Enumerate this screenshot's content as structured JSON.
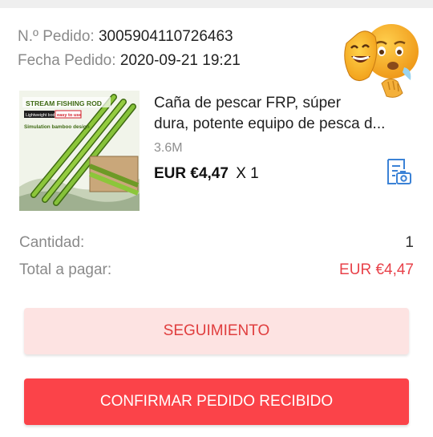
{
  "order": {
    "number_label": "N.º Pedido:",
    "number_value": "3005904110726463",
    "date_label": "Fecha Pedido:",
    "date_value": "2020-09-21 19:21"
  },
  "product": {
    "image_text": {
      "brand": "STREAM FISHING ROD",
      "tag1": "Lightweight body",
      "tag2": "easy to use",
      "subtitle": "Simulation bamboo design"
    },
    "title_line1": "Caña de pescar FRP, súper",
    "title_line2": "dura, potente equipo de pesca d...",
    "sku": "3.6M",
    "price": "EUR €4,47",
    "quantity": "X 1",
    "receipt_icon": "receipt-camera-icon"
  },
  "summary": {
    "quantity_label": "Cantidad:",
    "quantity_value": "1",
    "total_label": "Total a pagar:",
    "total_value": "EUR €4,47"
  },
  "buttons": {
    "track_label": "SEGUIMIENTO",
    "confirm_label": "CONFIRMAR PEDIDO RECIBIDO"
  },
  "colors": {
    "accent_red": "#fb4349",
    "price_red": "#e8424a",
    "track_bg": "#fde3e2",
    "icon_blue": "#3b82d6"
  }
}
